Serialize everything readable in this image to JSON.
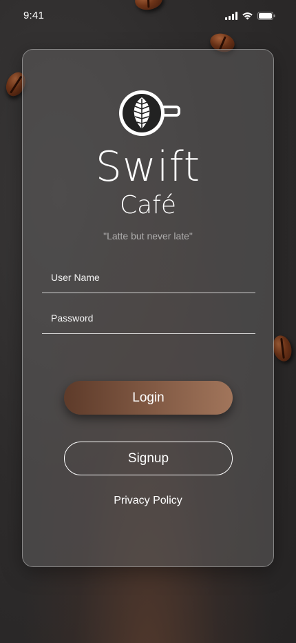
{
  "status_bar": {
    "time": "9:41",
    "signal_icon": "cellular-signal-icon",
    "wifi_icon": "wifi-icon",
    "battery_icon": "battery-icon"
  },
  "brand": {
    "logo_icon": "latte-art-cup-icon",
    "title": "Swift",
    "subtitle": "Café",
    "tagline": "\"Latte but never late\""
  },
  "form": {
    "username_placeholder": "User Name",
    "password_placeholder": "Password"
  },
  "actions": {
    "login_label": "Login",
    "signup_label": "Signup",
    "privacy_label": "Privacy Policy"
  },
  "colors": {
    "background": "#2d2b2b",
    "login_gradient_start": "#5e3b2a",
    "login_gradient_end": "#a1755b",
    "text": "#ffffff"
  }
}
